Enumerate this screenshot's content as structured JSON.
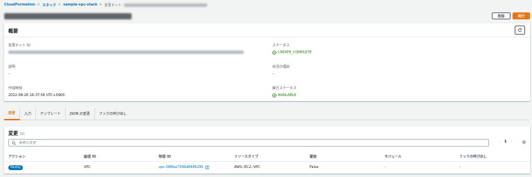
{
  "breadcrumb": {
    "items": [
      "CloudFormation",
      "スタック",
      "sample-vpc-stack",
      "変更セット"
    ],
    "separator": ">"
  },
  "header": {
    "delete_label": "削除",
    "execute_label": "実行"
  },
  "overview": {
    "title": "概要",
    "change_set_id_label": "変更セット ID",
    "description_label": "説明",
    "description_value": "-",
    "created_label": "作成時刻",
    "created_value": "2022-08-26 16:37:56 UTC+0900",
    "status_label": "ステータス",
    "status_value": "CREATE_COMPLETE",
    "reason_label": "状況の理由",
    "reason_value": "-",
    "exec_status_label": "実行ステータス",
    "exec_status_value": "AVAILABLE"
  },
  "tabs": [
    "変更",
    "入力",
    "テンプレート",
    "JSON の変更",
    "フックの呼び出し"
  ],
  "changes": {
    "title": "変更",
    "count": "(1)",
    "search_placeholder": "検索の変更",
    "page": "1",
    "columns": [
      "アクション",
      "論理 ID",
      "物理 ID",
      "リソースタイプ",
      "置換",
      "モジュール",
      "フックの呼び出し"
    ],
    "rows": [
      {
        "action": "Modify",
        "logical_id": "VPC",
        "physical_id": "vpc-088ba7306d8446295",
        "resource_type": "AWS::EC2::VPC",
        "replacement": "False",
        "module": "-",
        "hooks": "-"
      }
    ]
  },
  "colors": {
    "accent": "#ec7211",
    "link": "#0073bb",
    "success": "#1d8102"
  }
}
